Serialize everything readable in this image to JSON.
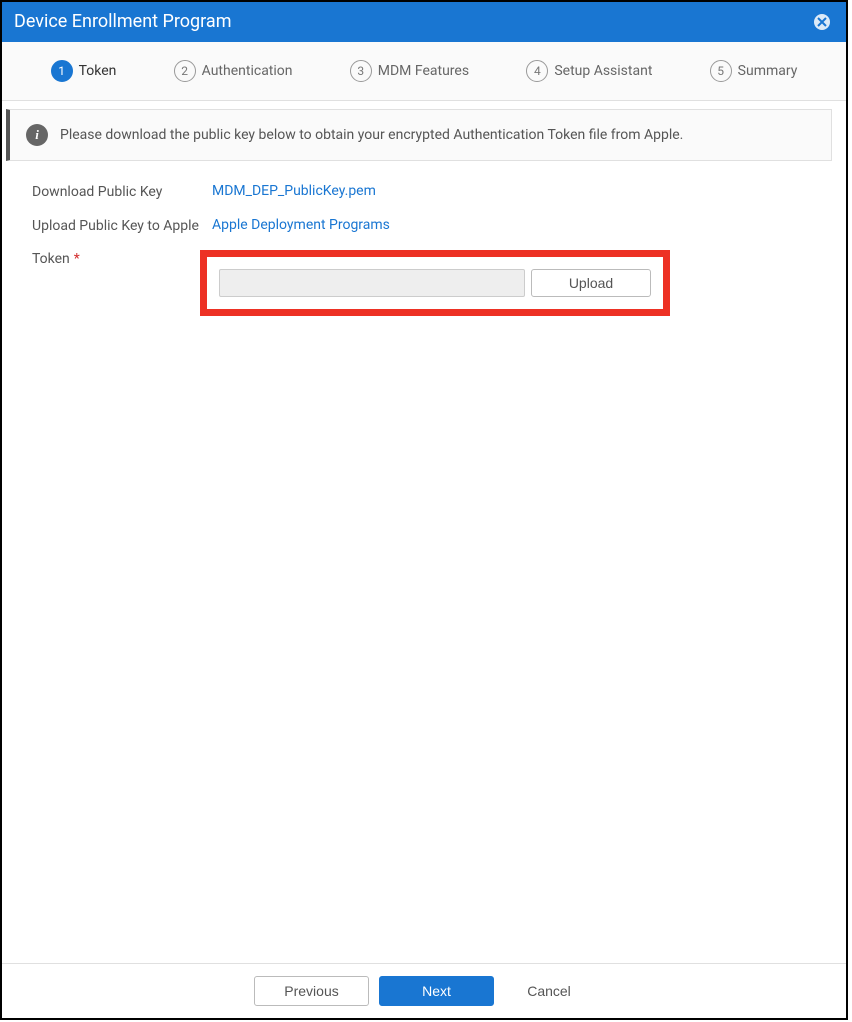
{
  "header": {
    "title": "Device Enrollment Program"
  },
  "steps": [
    {
      "num": "1",
      "label": "Token",
      "active": true
    },
    {
      "num": "2",
      "label": "Authentication",
      "active": false
    },
    {
      "num": "3",
      "label": "MDM Features",
      "active": false
    },
    {
      "num": "4",
      "label": "Setup Assistant",
      "active": false
    },
    {
      "num": "5",
      "label": "Summary",
      "active": false
    }
  ],
  "info": {
    "text": "Please download the public key below to obtain your encrypted Authentication Token file from Apple."
  },
  "form": {
    "download_label": "Download Public Key",
    "download_link": "MDM_DEP_PublicKey.pem",
    "upload_label": "Upload Public Key to Apple",
    "upload_link": "Apple Deployment Programs",
    "token_label": "Token",
    "upload_button": "Upload"
  },
  "footer": {
    "previous": "Previous",
    "next": "Next",
    "cancel": "Cancel"
  }
}
